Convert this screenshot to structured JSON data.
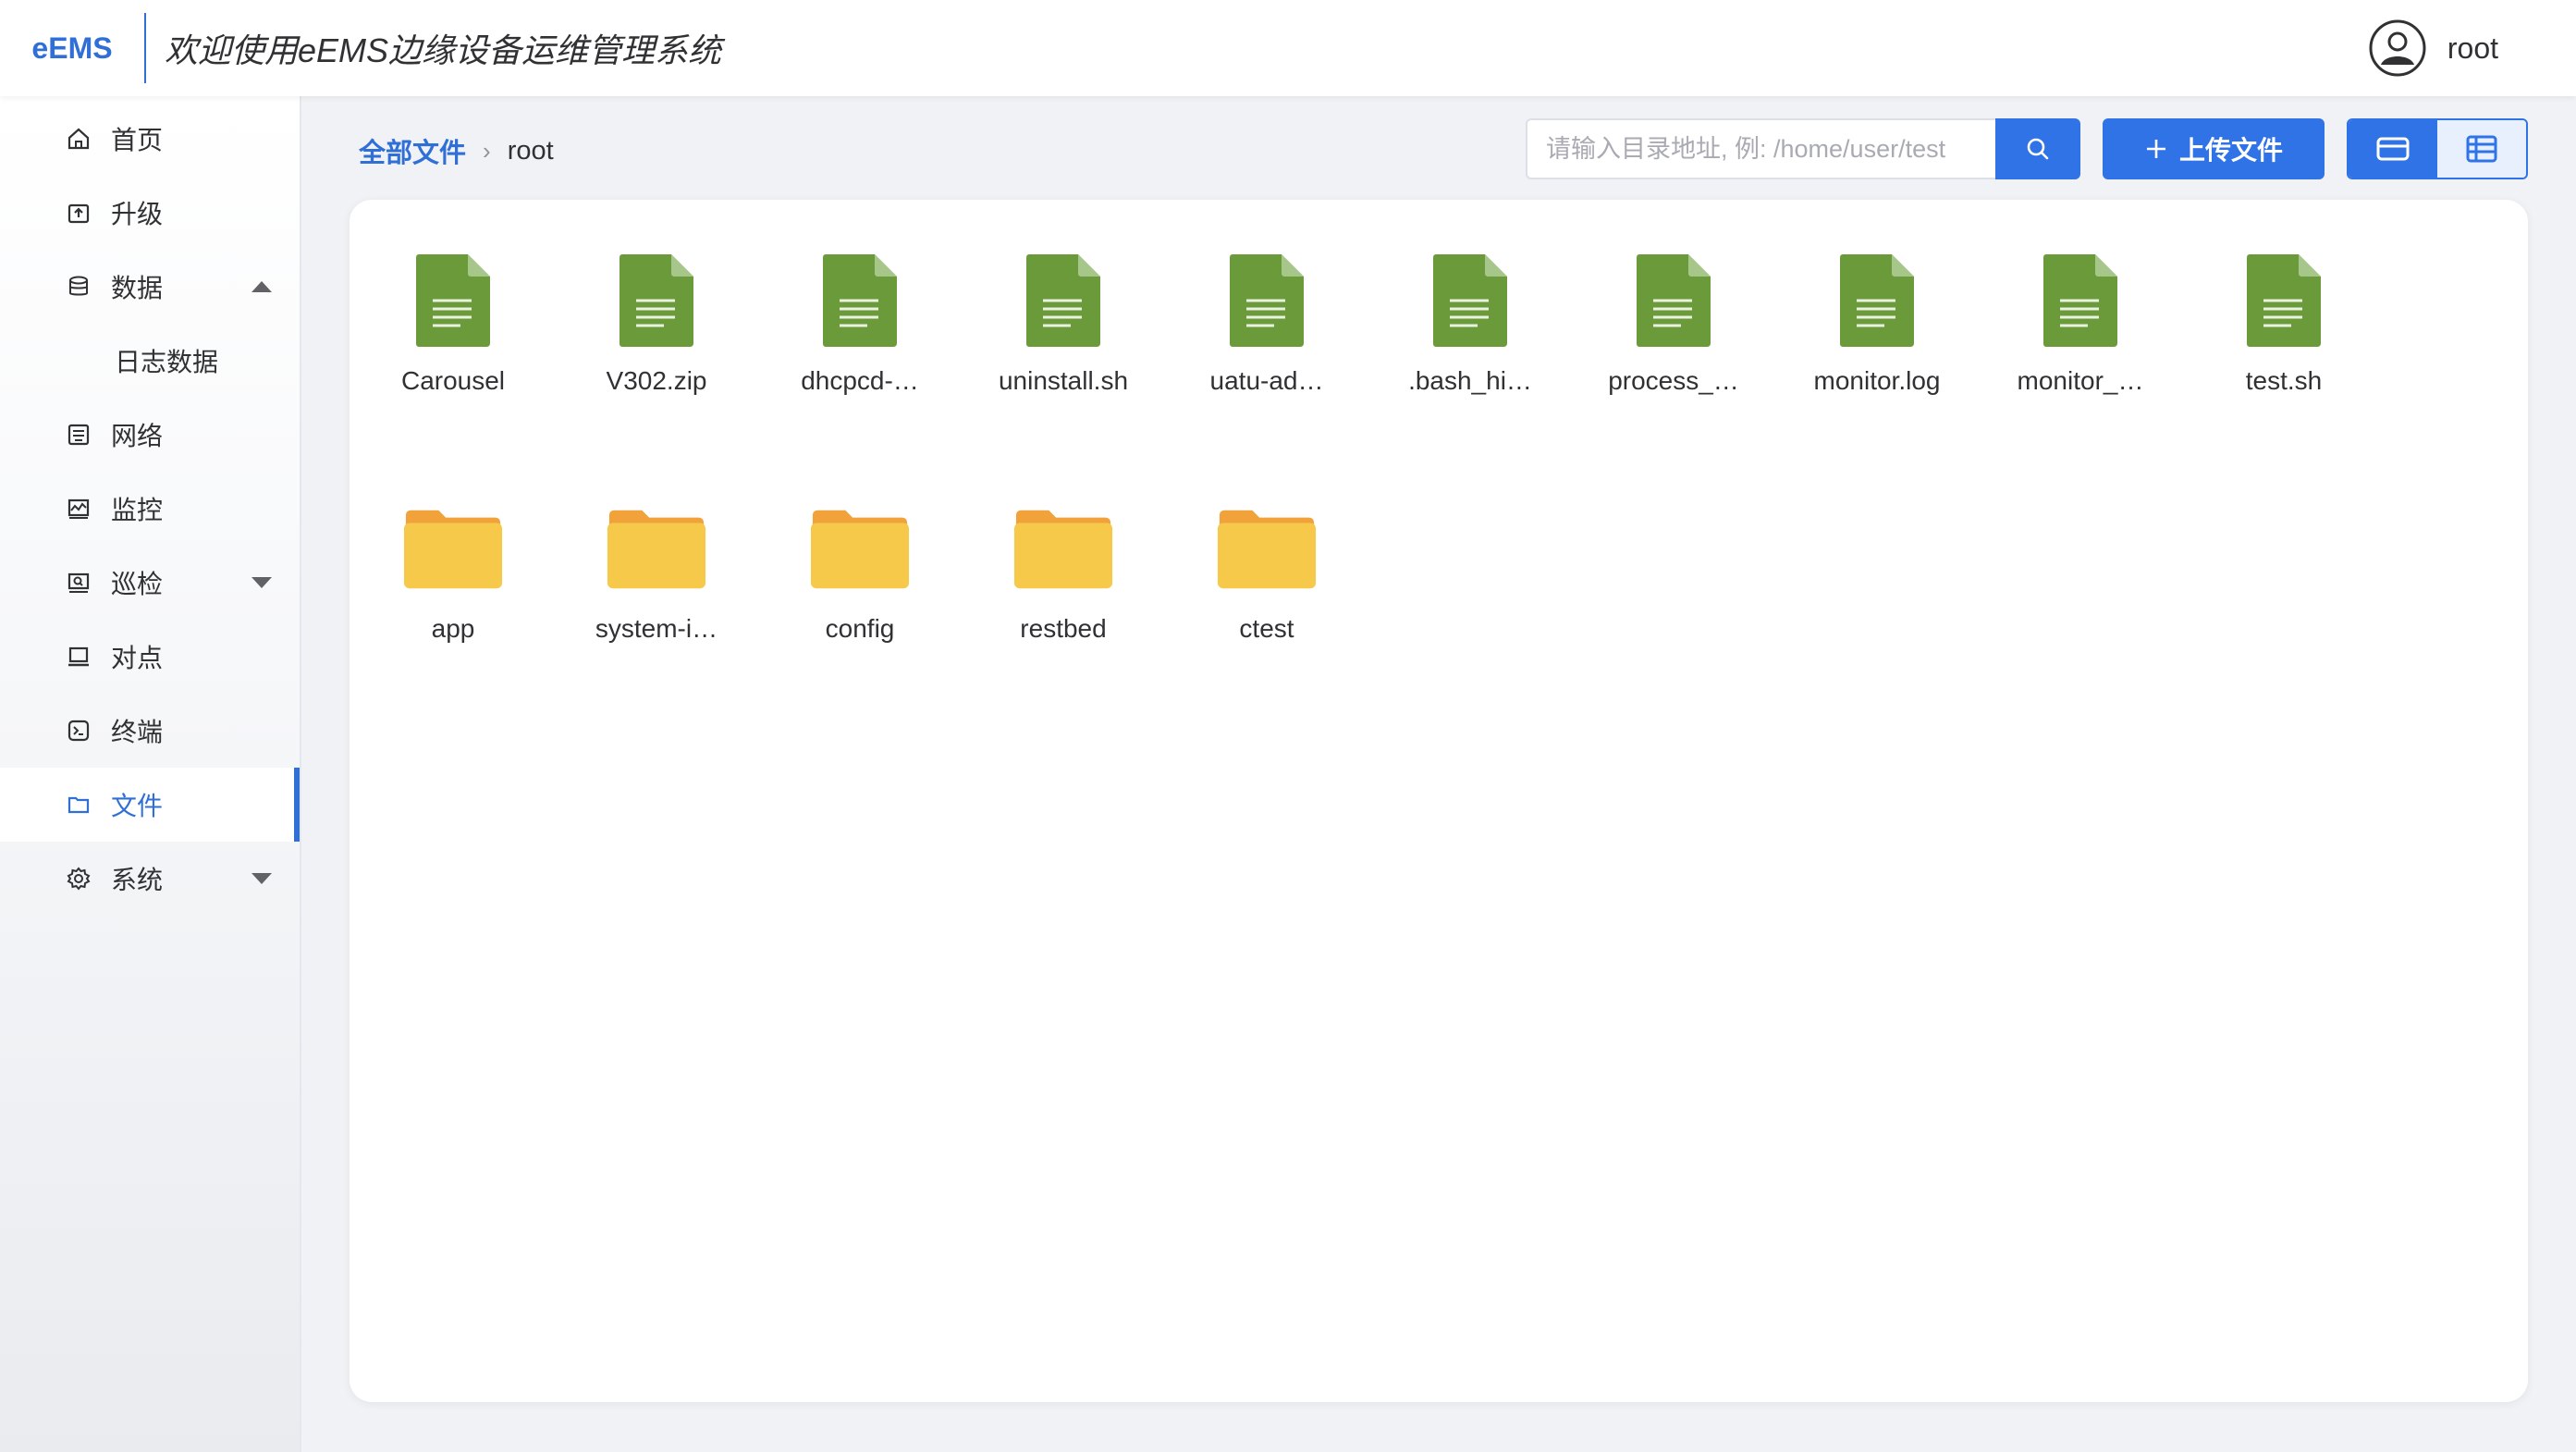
{
  "header": {
    "logo": "eEMS",
    "title": "欢迎使用eEMS边缘设备运维管理系统",
    "user_name": "root"
  },
  "sidebar": {
    "items": [
      {
        "label": "首页",
        "icon": "home-icon"
      },
      {
        "label": "升级",
        "icon": "upgrade-icon"
      },
      {
        "label": "数据",
        "icon": "database-icon",
        "expanded": true
      },
      {
        "label": "日志数据",
        "sub": true
      },
      {
        "label": "网络",
        "icon": "network-icon"
      },
      {
        "label": "监控",
        "icon": "monitor-icon"
      },
      {
        "label": "巡检",
        "icon": "inspect-icon",
        "expanded": false
      },
      {
        "label": "对点",
        "icon": "laptop-icon"
      },
      {
        "label": "终端",
        "icon": "terminal-icon"
      },
      {
        "label": "文件",
        "icon": "folder-icon",
        "active": true
      },
      {
        "label": "系统",
        "icon": "gear-icon",
        "expanded": false
      }
    ]
  },
  "breadcrumb": {
    "root": "全部文件",
    "current": "root"
  },
  "search": {
    "placeholder": "请输入目录地址, 例: /home/user/test",
    "value": ""
  },
  "upload_label": "上传文件",
  "colors": {
    "accent": "#2f73e6",
    "file_green": "#6a9a3a",
    "folder_yellow": "#f7c94b"
  },
  "files": [
    {
      "name": "Carousel",
      "type": "file"
    },
    {
      "name": "V302.zip",
      "type": "file"
    },
    {
      "name": "dhcpcd-…",
      "type": "file"
    },
    {
      "name": "uninstall.sh",
      "type": "file"
    },
    {
      "name": "uatu-ad…",
      "type": "file"
    },
    {
      "name": ".bash_hi…",
      "type": "file"
    },
    {
      "name": "process_…",
      "type": "file"
    },
    {
      "name": "monitor.log",
      "type": "file"
    },
    {
      "name": "monitor_…",
      "type": "file"
    },
    {
      "name": "test.sh",
      "type": "file"
    },
    {
      "name": "app",
      "type": "folder"
    },
    {
      "name": "system-i…",
      "type": "folder"
    },
    {
      "name": "config",
      "type": "folder"
    },
    {
      "name": "restbed",
      "type": "folder"
    },
    {
      "name": "ctest",
      "type": "folder"
    }
  ]
}
